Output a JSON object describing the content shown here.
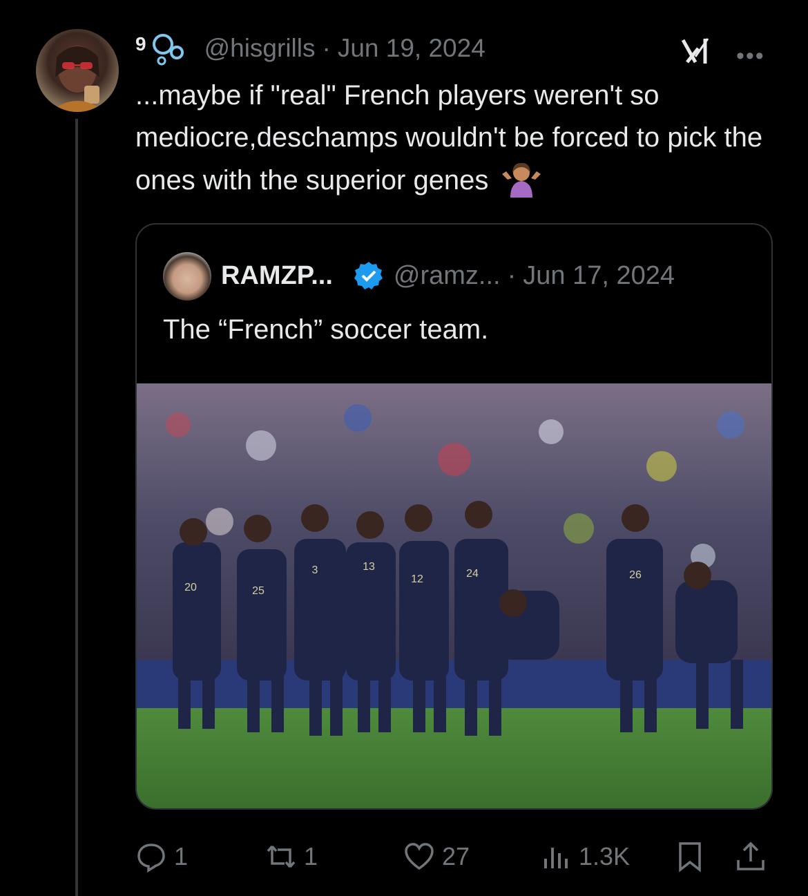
{
  "tweet": {
    "display_name_fragment": "9",
    "handle": "@hisgrills",
    "separator": "·",
    "date": "Jun 19, 2024",
    "text": "...maybe if \"real\" French players weren't so mediocre,deschamps wouldn't be forced to pick the ones with the superior genes",
    "shrug_emoji": "woman-shrugging-icon"
  },
  "quoted": {
    "name": "RAMZP...",
    "handle": "@ramz...",
    "separator": "·",
    "date": "Jun 17, 2024",
    "text": "The “French” soccer team.",
    "jersey_numbers": [
      "20",
      "25",
      "3",
      "13",
      "12",
      "24",
      "26"
    ]
  },
  "actions": {
    "reply_count": "1",
    "retweet_count": "1",
    "like_count": "27",
    "views_count": "1.3K"
  },
  "colors": {
    "background": "#000000",
    "text_primary": "#e7e9ea",
    "text_secondary": "#71767b",
    "border": "#2f3336",
    "verified_blue": "#1d9bf0",
    "pitch_green": "#3f7d33",
    "jersey_navy": "#1e2547"
  }
}
